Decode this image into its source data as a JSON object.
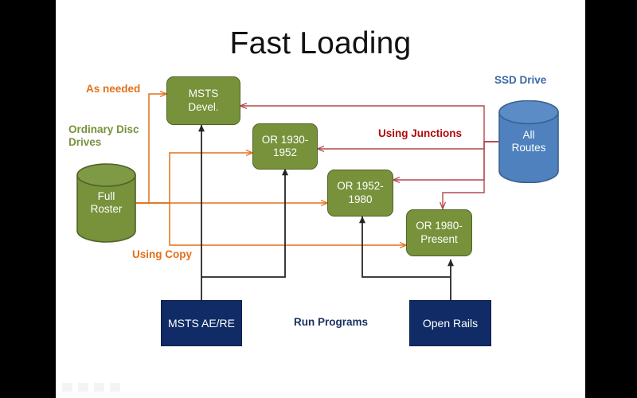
{
  "slide": {
    "title": "Fast Loading",
    "background": "#ffffff",
    "letterbox_color": "#000000"
  },
  "palette": {
    "green_fill": "#77923B",
    "green_stroke": "#4F6228",
    "navy_fill": "#102B66",
    "blue_cylinder": "#4E81BD",
    "orange_arrow": "#E3701A",
    "red_arrow": "#B4484B",
    "black_arrow": "#262626",
    "title_color": "#111111"
  },
  "labels": {
    "as_needed": "As needed",
    "ordinary_disc_drives": "Ordinary Disc\nDrives",
    "using_copy": "Using Copy",
    "using_junctions": "Using Junctions",
    "ssd_drive": "SSD Drive",
    "run_programs": "Run Programs"
  },
  "cylinders": [
    {
      "id": "full-roster",
      "text": "Full\nRoster",
      "color": "#77923B",
      "caption": "Ordinary Disc Drives"
    },
    {
      "id": "all-routes",
      "text": "All\nRoutes",
      "color": "#4E81BD",
      "caption": "SSD Drive"
    }
  ],
  "process_boxes": [
    {
      "id": "msts-devel",
      "text": "MSTS\nDevel."
    },
    {
      "id": "or-1930-1952",
      "text": "OR 1930-\n1952"
    },
    {
      "id": "or-1952-1980",
      "text": "OR 1952-\n1980"
    },
    {
      "id": "or-1980-present",
      "text": "OR 1980-\nPresent"
    }
  ],
  "program_boxes": [
    {
      "id": "msts-ae-re",
      "text": "MSTS AE/RE"
    },
    {
      "id": "open-rails",
      "text": "Open Rails"
    }
  ],
  "flows": [
    {
      "from": "Full Roster",
      "to": "MSTS Devel.",
      "label": "As needed",
      "color": "#E3701A"
    },
    {
      "from": "Full Roster",
      "to": "OR 1930-1952",
      "label": "Using Copy",
      "color": "#E3701A"
    },
    {
      "from": "Full Roster",
      "to": "OR 1952-1980",
      "label": "Using Copy",
      "color": "#E3701A"
    },
    {
      "from": "Full Roster",
      "to": "OR 1980-Present",
      "label": "Using Copy",
      "color": "#E3701A"
    },
    {
      "from": "All Routes",
      "to": "MSTS Devel.",
      "label": "Using Junctions",
      "color": "#B4484B"
    },
    {
      "from": "All Routes",
      "to": "OR 1930-1952",
      "label": "Using Junctions",
      "color": "#B4484B"
    },
    {
      "from": "All Routes",
      "to": "OR 1952-1980",
      "label": "Using Junctions",
      "color": "#B4484B"
    },
    {
      "from": "All Routes",
      "to": "OR 1980-Present",
      "label": "Using Junctions",
      "color": "#B4484B"
    },
    {
      "from": "MSTS AE/RE",
      "to": "MSTS Devel.",
      "label": "Run Programs",
      "color": "#262626"
    },
    {
      "from": "MSTS AE/RE",
      "to": "OR 1930-1952",
      "label": "Run Programs",
      "color": "#262626"
    },
    {
      "from": "Open Rails",
      "to": "OR 1952-1980",
      "label": "Run Programs",
      "color": "#262626"
    },
    {
      "from": "Open Rails",
      "to": "OR 1980-Present",
      "label": "Run Programs",
      "color": "#262626"
    }
  ],
  "toolbar": {
    "icons": [
      "pointer-icon",
      "pen-icon",
      "slide-icon",
      "menu-icon"
    ]
  }
}
